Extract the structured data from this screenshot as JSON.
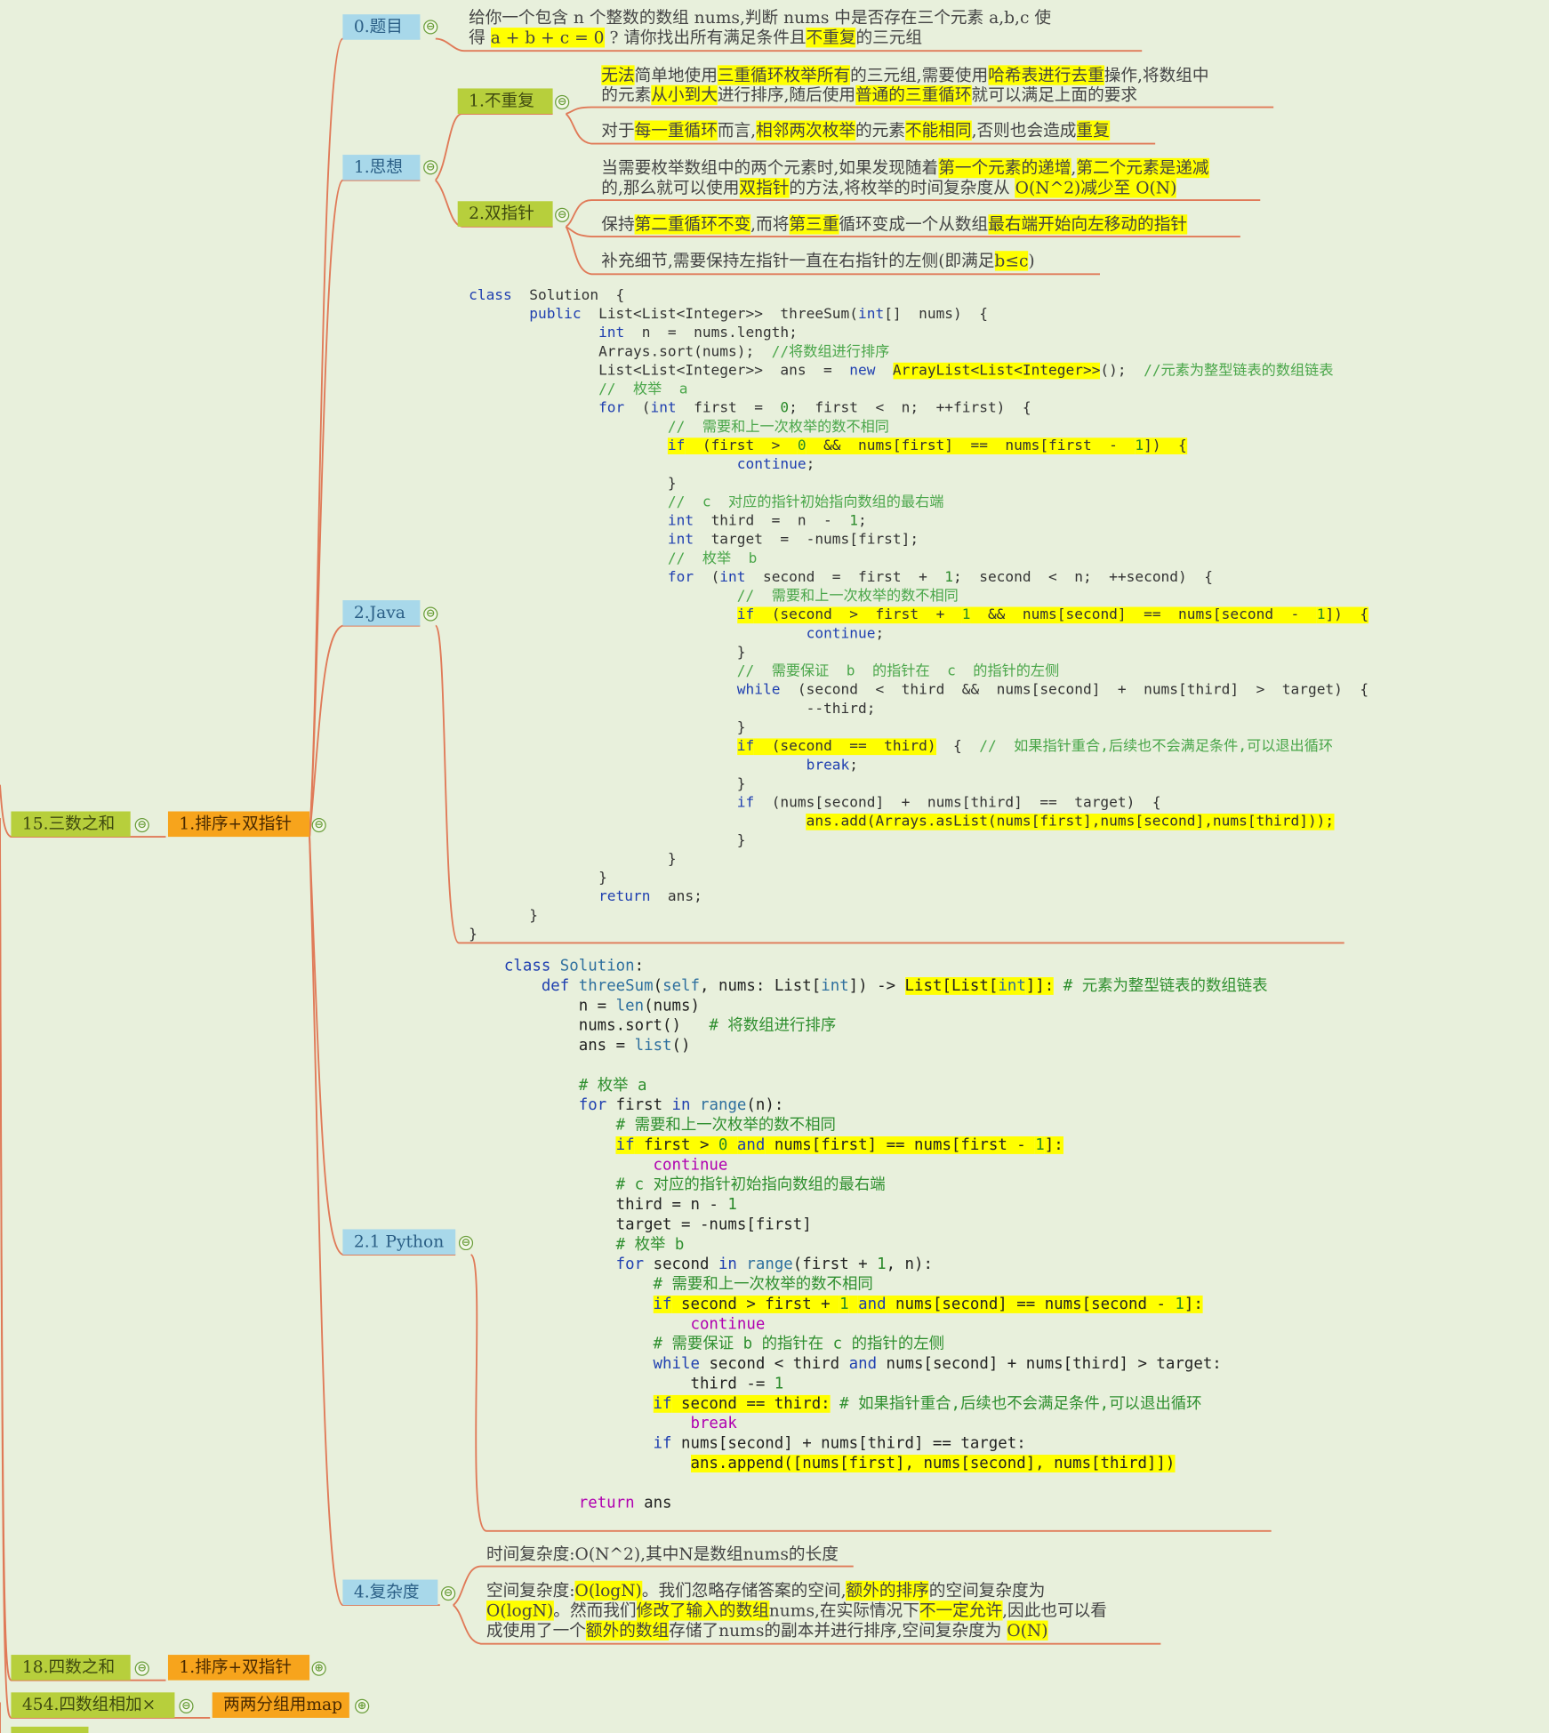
{
  "colors": {
    "background": "#e8f0dc",
    "link": "#e07a58",
    "blue_node": "#a8d8ea",
    "green_node": "#b7cf3c",
    "orange_node": "#f7a41c",
    "highlight": "#ffff00"
  },
  "nodes": {
    "problem": "0.题目",
    "idea": "1.思想",
    "nodup": "1.不重复",
    "twoptr": "2.双指针",
    "java": "2.Java",
    "python": "2.1 Python",
    "complexity": "4.复杂度",
    "three_sum": "15.三数之和",
    "sort_twoptr": "1.排序+双指针",
    "four_sum": "18.四数之和",
    "four_sum_sub": "1.排序+双指针",
    "four_add": "454.四数组相加×",
    "four_add_sub": "两两分组用map"
  },
  "toggles": {
    "collapse": "⊖",
    "expand": "⊕"
  },
  "problem_text": {
    "l1": "给你一个包含 n 个整数的数组  nums,判断  nums  中是否存在三个元素 a,b,c 使",
    "l2a": "得 ",
    "l2b": "a + b + c = 0",
    "l2c": " ? 请你找出所有满足条件且",
    "l2d": "不重复",
    "l2e": "的三元组"
  },
  "nodup_text": {
    "p1": [
      "无法",
      "简单地使用",
      "三重循环枚举所有",
      "的三元组,需要使用",
      "哈希表进行去重",
      "操作,将数组中"
    ],
    "p1b": [
      "的元素",
      "从小到大",
      "进行排序,随后使用",
      "普通的三重循环",
      "就可以满足上面的要求"
    ],
    "p2": [
      "对于",
      "每一重循环",
      "而言,",
      "相邻两次枚举",
      "的元素",
      "不能相同",
      ",否则也会造成",
      "重复"
    ]
  },
  "twoptr_text": {
    "p1": [
      "当需要枚举数组中的两个元素时,如果发现随着",
      "第一个元素的递增",
      ",",
      "第二个元素是递减"
    ],
    "p1b": [
      "的,那么就可以使用",
      "双指针",
      "的方法,将枚举的时间复杂度从 ",
      "O(N^2)减少至 O(N)"
    ],
    "p2": [
      "保持",
      "第二重循环不变",
      ",而将",
      "第三重",
      "循环变成一个从数组",
      "最右端开始向左移动的指针"
    ],
    "p3": [
      "补充细节,需要保持左指针一直在右指针的左侧(即满足",
      "b≤c",
      ")"
    ]
  },
  "java_code": [
    [
      [
        "k",
        "class"
      ],
      [
        "t",
        "  Solution  {"
      ]
    ],
    [
      [
        "t",
        "       "
      ],
      [
        "k",
        "public"
      ],
      [
        "t",
        "  List<List<Integer>>  threeSum("
      ],
      [
        "k",
        "int"
      ],
      [
        "t",
        "[]  nums)  {"
      ]
    ],
    [
      [
        "t",
        "               "
      ],
      [
        "k",
        "int"
      ],
      [
        "t",
        "  n  =  nums.length;"
      ]
    ],
    [
      [
        "t",
        "               Arrays.sort(nums);  "
      ],
      [
        "c",
        "//将数组进行排序"
      ]
    ],
    [
      [
        "t",
        "               List<List<Integer>>  ans  =  "
      ],
      [
        "k",
        "new"
      ],
      [
        "t",
        "  "
      ],
      [
        "h",
        "ArrayList<List<Integer>>"
      ],
      [
        "t",
        "();  "
      ],
      [
        "c",
        "//元素为整型链表的数组链表"
      ]
    ],
    [
      [
        "t",
        "               "
      ],
      [
        "c",
        "//  枚举  a"
      ]
    ],
    [
      [
        "t",
        "               "
      ],
      [
        "k",
        "for"
      ],
      [
        "t",
        "  ("
      ],
      [
        "k",
        "int"
      ],
      [
        "t",
        "  first  =  "
      ],
      [
        "n",
        "0"
      ],
      [
        "t",
        ";  first  <  n;  ++first)  {"
      ]
    ],
    [
      [
        "t",
        "                       "
      ],
      [
        "c",
        "//  需要和上一次枚举的数不相同"
      ]
    ],
    [
      [
        "t",
        "                       "
      ],
      [
        "hk",
        "if"
      ],
      [
        "h",
        "  (first  >  "
      ],
      [
        "hn",
        "0"
      ],
      [
        "h",
        "  &&  nums[first]  ==  nums[first  -  "
      ],
      [
        "hn",
        "1"
      ],
      [
        "h",
        "])  {"
      ]
    ],
    [
      [
        "t",
        "                               "
      ],
      [
        "k",
        "continue"
      ],
      [
        "t",
        ";"
      ]
    ],
    [
      [
        "t",
        "                       }"
      ]
    ],
    [
      [
        "t",
        "                       "
      ],
      [
        "c",
        "//  c  对应的指针初始指向数组的最右端"
      ]
    ],
    [
      [
        "t",
        "                       "
      ],
      [
        "k",
        "int"
      ],
      [
        "t",
        "  third  =  n  -  "
      ],
      [
        "n",
        "1"
      ],
      [
        "t",
        ";"
      ]
    ],
    [
      [
        "t",
        "                       "
      ],
      [
        "k",
        "int"
      ],
      [
        "t",
        "  target  =  -nums[first];"
      ]
    ],
    [
      [
        "t",
        "                       "
      ],
      [
        "c",
        "//  枚举  b"
      ]
    ],
    [
      [
        "t",
        "                       "
      ],
      [
        "k",
        "for"
      ],
      [
        "t",
        "  ("
      ],
      [
        "k",
        "int"
      ],
      [
        "t",
        "  second  =  first  +  "
      ],
      [
        "n",
        "1"
      ],
      [
        "t",
        ";  second  <  n;  ++second)  {"
      ]
    ],
    [
      [
        "t",
        "                               "
      ],
      [
        "c",
        "//  需要和上一次枚举的数不相同"
      ]
    ],
    [
      [
        "t",
        "                               "
      ],
      [
        "hk",
        "if"
      ],
      [
        "h",
        "  (second  >  first  +  "
      ],
      [
        "hn",
        "1"
      ],
      [
        "h",
        "  &&  nums[second]  ==  nums[second  -  "
      ],
      [
        "hn",
        "1"
      ],
      [
        "h",
        "])  {"
      ]
    ],
    [
      [
        "t",
        "                                       "
      ],
      [
        "k",
        "continue"
      ],
      [
        "t",
        ";"
      ]
    ],
    [
      [
        "t",
        "                               }"
      ]
    ],
    [
      [
        "t",
        "                               "
      ],
      [
        "c",
        "//  需要保证  b  的指针在  c  的指针的左侧"
      ]
    ],
    [
      [
        "t",
        "                               "
      ],
      [
        "k",
        "while"
      ],
      [
        "t",
        "  (second  <  third  &&  nums[second]  +  nums[third]  >  target)  {"
      ]
    ],
    [
      [
        "t",
        "                                       --third;"
      ]
    ],
    [
      [
        "t",
        "                               }"
      ]
    ],
    [
      [
        "t",
        "                               "
      ],
      [
        "hk",
        "if"
      ],
      [
        "h",
        "  (second  ==  third)"
      ],
      [
        "t",
        "  {  "
      ],
      [
        "c",
        "//  如果指针重合,后续也不会满足条件,可以退出循环"
      ]
    ],
    [
      [
        "t",
        "                                       "
      ],
      [
        "k",
        "break"
      ],
      [
        "t",
        ";"
      ]
    ],
    [
      [
        "t",
        "                               }"
      ]
    ],
    [
      [
        "t",
        "                               "
      ],
      [
        "k",
        "if"
      ],
      [
        "t",
        "  (nums[second]  +  nums[third]  ==  target)  {"
      ]
    ],
    [
      [
        "t",
        "                                       "
      ],
      [
        "h",
        "ans.add(Arrays.asList(nums[first],nums[second],nums[third]));"
      ]
    ],
    [
      [
        "t",
        "                               }"
      ]
    ],
    [
      [
        "t",
        "                       }"
      ]
    ],
    [
      [
        "t",
        "               }"
      ]
    ],
    [
      [
        "t",
        "               "
      ],
      [
        "k",
        "return"
      ],
      [
        "t",
        "  ans;"
      ]
    ],
    [
      [
        "t",
        "       }"
      ]
    ],
    [
      [
        "t",
        "}"
      ]
    ]
  ],
  "python_code": [
    [
      [
        "k",
        "class"
      ],
      [
        "t",
        " "
      ],
      [
        "b",
        "Solution"
      ],
      [
        "t",
        ":"
      ]
    ],
    [
      [
        "t",
        "    "
      ],
      [
        "k",
        "def"
      ],
      [
        "t",
        " "
      ],
      [
        "b",
        "threeSum"
      ],
      [
        "t",
        "("
      ],
      [
        "b",
        "self"
      ],
      [
        "t",
        ", nums: List["
      ],
      [
        "b",
        "int"
      ],
      [
        "t",
        "]) -> "
      ],
      [
        "h",
        "List[List["
      ],
      [
        "hb",
        "int"
      ],
      [
        "h",
        "]]:"
      ],
      [
        "t",
        " "
      ],
      [
        "c",
        "# 元素为整型链表的数组链表"
      ]
    ],
    [
      [
        "t",
        "        n = "
      ],
      [
        "b",
        "len"
      ],
      [
        "t",
        "(nums)"
      ]
    ],
    [
      [
        "t",
        "        nums.sort()   "
      ],
      [
        "c",
        "# 将数组进行排序"
      ]
    ],
    [
      [
        "t",
        "        ans = "
      ],
      [
        "b",
        "list"
      ],
      [
        "t",
        "()"
      ]
    ],
    [
      [
        "t",
        ""
      ]
    ],
    [
      [
        "t",
        "        "
      ],
      [
        "c",
        "# 枚举 a"
      ]
    ],
    [
      [
        "t",
        "        "
      ],
      [
        "k",
        "for"
      ],
      [
        "t",
        " first "
      ],
      [
        "k",
        "in"
      ],
      [
        "t",
        " "
      ],
      [
        "b",
        "range"
      ],
      [
        "t",
        "(n):"
      ]
    ],
    [
      [
        "t",
        "            "
      ],
      [
        "c",
        "# 需要和上一次枚举的数不相同"
      ]
    ],
    [
      [
        "t",
        "            "
      ],
      [
        "hk",
        "if"
      ],
      [
        "h",
        " first > "
      ],
      [
        "hn",
        "0"
      ],
      [
        "h",
        " "
      ],
      [
        "hk",
        "and"
      ],
      [
        "h",
        " nums[first] == nums[first - "
      ],
      [
        "hn",
        "1"
      ],
      [
        "h",
        "]:"
      ]
    ],
    [
      [
        "t",
        "                "
      ],
      [
        "p",
        "continue"
      ]
    ],
    [
      [
        "t",
        "            "
      ],
      [
        "c",
        "# c 对应的指针初始指向数组的最右端"
      ]
    ],
    [
      [
        "t",
        "            third = n - "
      ],
      [
        "n",
        "1"
      ]
    ],
    [
      [
        "t",
        "            target = -nums[first]"
      ]
    ],
    [
      [
        "t",
        "            "
      ],
      [
        "c",
        "# 枚举 b"
      ]
    ],
    [
      [
        "t",
        "            "
      ],
      [
        "k",
        "for"
      ],
      [
        "t",
        " second "
      ],
      [
        "k",
        "in"
      ],
      [
        "t",
        " "
      ],
      [
        "b",
        "range"
      ],
      [
        "t",
        "(first + "
      ],
      [
        "n",
        "1"
      ],
      [
        "t",
        ", n):"
      ]
    ],
    [
      [
        "t",
        "                "
      ],
      [
        "c",
        "# 需要和上一次枚举的数不相同"
      ]
    ],
    [
      [
        "t",
        "                "
      ],
      [
        "hk",
        "if"
      ],
      [
        "h",
        " second > first + "
      ],
      [
        "hn",
        "1"
      ],
      [
        "h",
        " "
      ],
      [
        "hk",
        "and"
      ],
      [
        "h",
        " nums[second] == nums[second - "
      ],
      [
        "hn",
        "1"
      ],
      [
        "h",
        "]:"
      ]
    ],
    [
      [
        "t",
        "                    "
      ],
      [
        "p",
        "continue"
      ]
    ],
    [
      [
        "t",
        "                "
      ],
      [
        "c",
        "# 需要保证 b 的指针在 c 的指针的左侧"
      ]
    ],
    [
      [
        "t",
        "                "
      ],
      [
        "k",
        "while"
      ],
      [
        "t",
        " second < third "
      ],
      [
        "k",
        "and"
      ],
      [
        "t",
        " nums[second] + nums[third] > target:"
      ]
    ],
    [
      [
        "t",
        "                    third -= "
      ],
      [
        "n",
        "1"
      ]
    ],
    [
      [
        "t",
        "                "
      ],
      [
        "hk",
        "if"
      ],
      [
        "h",
        " second == third:"
      ],
      [
        "t",
        " "
      ],
      [
        "c",
        "# 如果指针重合,后续也不会满足条件,可以退出循环"
      ]
    ],
    [
      [
        "t",
        "                    "
      ],
      [
        "p",
        "break"
      ]
    ],
    [
      [
        "t",
        "                "
      ],
      [
        "k",
        "if"
      ],
      [
        "t",
        " nums[second] + nums[third] == target:"
      ]
    ],
    [
      [
        "t",
        "                    "
      ],
      [
        "h",
        "ans.append([nums[first], nums[second], nums[third]])"
      ]
    ],
    [
      [
        "t",
        ""
      ]
    ],
    [
      [
        "t",
        "        "
      ],
      [
        "p",
        "return"
      ],
      [
        "t",
        " ans"
      ]
    ]
  ],
  "complexity_text": {
    "time": "时间复杂度:O(N^2),其中N是数组nums的长度",
    "space1": [
      "空间复杂度:",
      "O(logN)",
      "。我们忽略存储答案的空间,",
      "额外的排序",
      "的空间复杂度为"
    ],
    "space2": [
      "O(logN)",
      "。然而我们",
      "修改了输入的数组",
      "nums,在实际情况下",
      "不一定允许",
      ",因此也可以看"
    ],
    "space3": [
      "成使用了一个",
      "额外的数组",
      "存储了nums的副本并进行排序,空间复杂度为 ",
      "O(N)"
    ]
  }
}
